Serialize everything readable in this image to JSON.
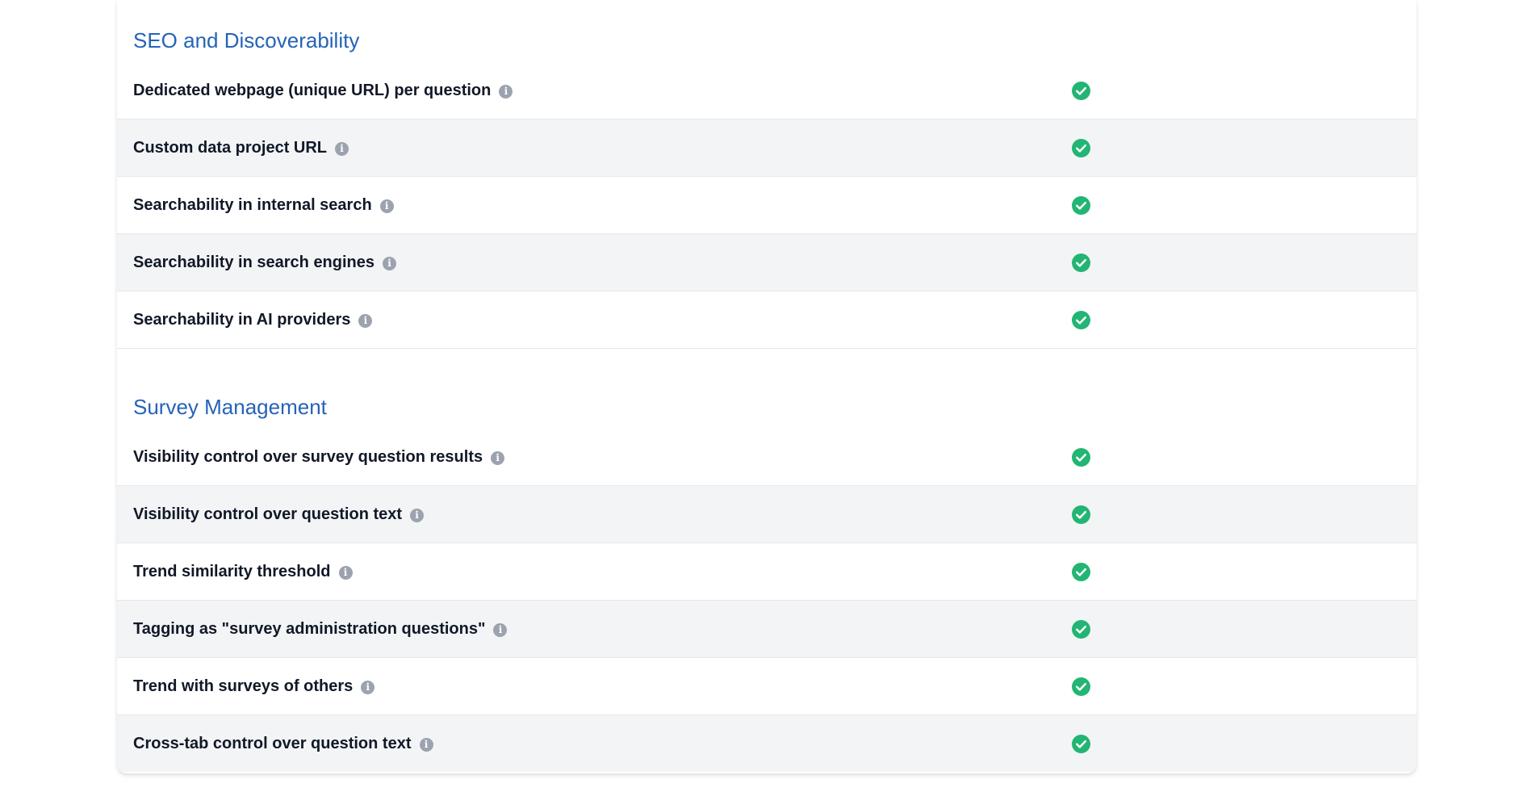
{
  "sections": [
    {
      "title": "SEO and Discoverability",
      "rows": [
        {
          "label": "Dedicated webpage (unique URL) per question",
          "included": true
        },
        {
          "label": "Custom data project URL",
          "included": true
        },
        {
          "label": "Searchability in internal search",
          "included": true
        },
        {
          "label": "Searchability in search engines",
          "included": true
        },
        {
          "label": "Searchability in AI providers",
          "included": true
        }
      ]
    },
    {
      "title": "Survey Management",
      "rows": [
        {
          "label": "Visibility control over survey question results",
          "included": true
        },
        {
          "label": "Visibility control over question text",
          "included": true
        },
        {
          "label": "Trend similarity threshold",
          "included": true
        },
        {
          "label": "Tagging as \"survey administration questions\"",
          "included": true
        },
        {
          "label": "Trend with surveys of others",
          "included": true
        },
        {
          "label": "Cross-tab control over question text",
          "included": true
        }
      ]
    }
  ],
  "icons": {
    "info": "info-icon",
    "check": "check-circle-icon"
  },
  "colors": {
    "section_title": "#2563b8",
    "check_green": "#22b573",
    "info_gray": "#9ca3af",
    "row_shaded": "#f3f4f6"
  }
}
